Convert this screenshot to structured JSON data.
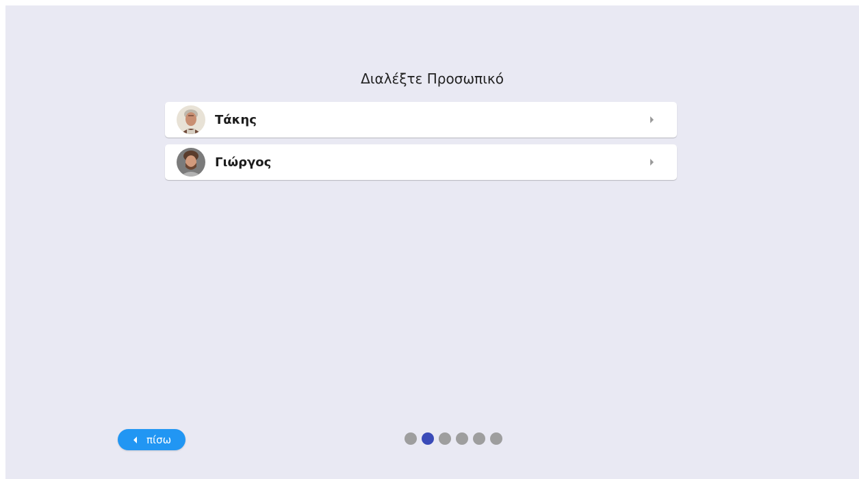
{
  "page": {
    "title": "Διαλέξτε Προσωπικό"
  },
  "staff": [
    {
      "name": "Τάκης",
      "avatar_icon": "person-photo-icon"
    },
    {
      "name": "Γιώργος",
      "avatar_icon": "person-photo-icon"
    }
  ],
  "footer": {
    "back_label": "πίσω",
    "pager": {
      "total": 6,
      "current": 2
    }
  },
  "colors": {
    "background": "#e9e9f3",
    "accent": "#2196f3",
    "pager_active": "#3a4bb8",
    "pager_inactive": "#9e9e9e"
  }
}
